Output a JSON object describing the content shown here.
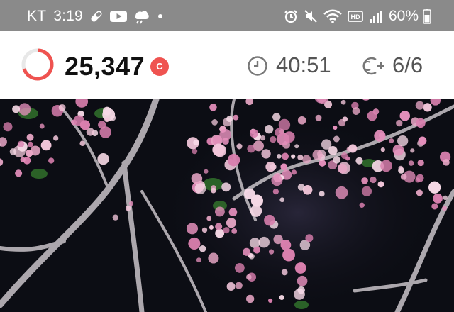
{
  "status_bar": {
    "carrier": "KT",
    "time": "3:19",
    "battery": "60%",
    "left_icons": [
      "pill-icon",
      "youtube-icon",
      "weather-icon",
      "dot-icon"
    ],
    "right_icons": [
      "alarm-icon",
      "mute-icon",
      "wifi-icon",
      "hd-icon",
      "signal-icon",
      "battery-icon"
    ]
  },
  "header": {
    "points": "25,347",
    "coin_label": "C",
    "timer": "40:51",
    "counter": "6/6",
    "progress": 0.7
  },
  "photo": {
    "subject": "cherry-blossom-night-photo"
  },
  "colors": {
    "accent": "#ef5350",
    "status_bar": "#8a8a8a",
    "text_dark": "#111111",
    "text_gray": "#555555"
  }
}
